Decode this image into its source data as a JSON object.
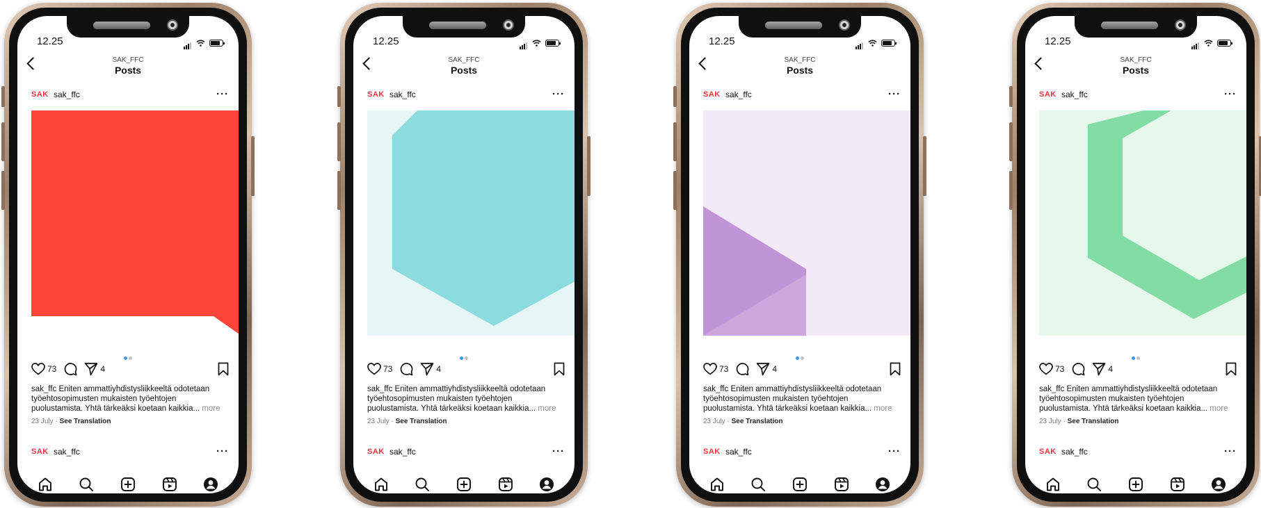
{
  "phones": [
    {
      "status": {
        "time": "12.25"
      },
      "header": {
        "username": "SAK_FFC",
        "title": "Posts"
      },
      "post": {
        "brand": "SAK",
        "account": "sak_ffc",
        "likes": "73",
        "shares": "4",
        "caption_user": "sak_ffc",
        "caption_text": "Eniten ammattiyhdistysliikkeeltä odotetaan työehtosopimusten mukaisten työehtojen puolustamista. Yhtä tärkeäksi koetaan kaikkia...",
        "more_label": "more",
        "date": "23 July",
        "separator": "·",
        "translation_label": "See Translation",
        "artwork": "speech-bubble",
        "colors": {
          "primary": "#FF453A",
          "background": "#FFFFFF"
        }
      },
      "next_post": {
        "brand": "SAK",
        "account": "sak_ffc"
      },
      "carousel": {
        "current": 1,
        "total": 2
      }
    },
    {
      "status": {
        "time": "12.25"
      },
      "header": {
        "username": "SAK_FFC",
        "title": "Posts"
      },
      "post": {
        "brand": "SAK",
        "account": "sak_ffc",
        "likes": "73",
        "shares": "4",
        "caption_user": "sak_ffc",
        "caption_text": "Eniten ammattiyhdistysliikkeeltä odotetaan työehtosopimusten mukaisten työehtojen puolustamista. Yhtä tärkeäksi koetaan kaikkia...",
        "more_label": "more",
        "date": "23 July",
        "separator": "·",
        "translation_label": "See Translation",
        "artwork": "hexagon",
        "colors": {
          "primary": "#8BDBDF",
          "background": "#E6F6F7"
        }
      },
      "next_post": {
        "brand": "SAK",
        "account": "sak_ffc"
      },
      "carousel": {
        "current": 1,
        "total": 2
      }
    },
    {
      "status": {
        "time": "12.25"
      },
      "header": {
        "username": "SAK_FFC",
        "title": "Posts"
      },
      "post": {
        "brand": "SAK",
        "account": "sak_ffc",
        "likes": "73",
        "shares": "4",
        "caption_user": "sak_ffc",
        "caption_text": "Eniten ammattiyhdistysliikkeeltä odotetaan työehtosopimusten mukaisten työehtojen puolustamista. Yhtä tärkeäksi koetaan kaikkia...",
        "more_label": "more",
        "date": "23 July",
        "separator": "·",
        "translation_label": "See Translation",
        "artwork": "triangle",
        "colors": {
          "primary": "#C094D6",
          "secondary": "#CDA6DD",
          "background": "#F2EAF7"
        }
      },
      "next_post": {
        "brand": "SAK",
        "account": "sak_ffc"
      },
      "carousel": {
        "current": 1,
        "total": 2
      }
    },
    {
      "status": {
        "time": "12.25"
      },
      "header": {
        "username": "SAK_FFC",
        "title": "Posts"
      },
      "post": {
        "brand": "SAK",
        "account": "sak_ffc",
        "likes": "73",
        "shares": "4",
        "caption_user": "sak_ffc",
        "caption_text": "Eniten ammattiyhdistysliikkeeltä odotetaan työehtosopimusten mukaisten työehtojen puolustamista. Yhtä tärkeäksi koetaan kaikkia...",
        "more_label": "more",
        "date": "23 July",
        "separator": "·",
        "translation_label": "See Translation",
        "artwork": "hexagon-outline",
        "colors": {
          "primary": "#82DCA3",
          "background": "#E6F7EC"
        }
      },
      "next_post": {
        "brand": "SAK",
        "account": "sak_ffc"
      },
      "carousel": {
        "current": 1,
        "total": 2
      }
    }
  ],
  "icons": {
    "status": [
      "signal-icon",
      "wifi-icon",
      "battery-icon"
    ],
    "actions": [
      "heart-icon",
      "comment-icon",
      "share-icon",
      "bookmark-icon"
    ],
    "tabbar": [
      "home-icon",
      "search-icon",
      "create-icon",
      "reels-icon",
      "profile-icon"
    ]
  },
  "colors": {
    "text": "#111111",
    "muted": "#8E8E8E",
    "brand_red": "#E8343C",
    "carousel_active": "#3897F0",
    "phone_frame": "#B89A80"
  }
}
